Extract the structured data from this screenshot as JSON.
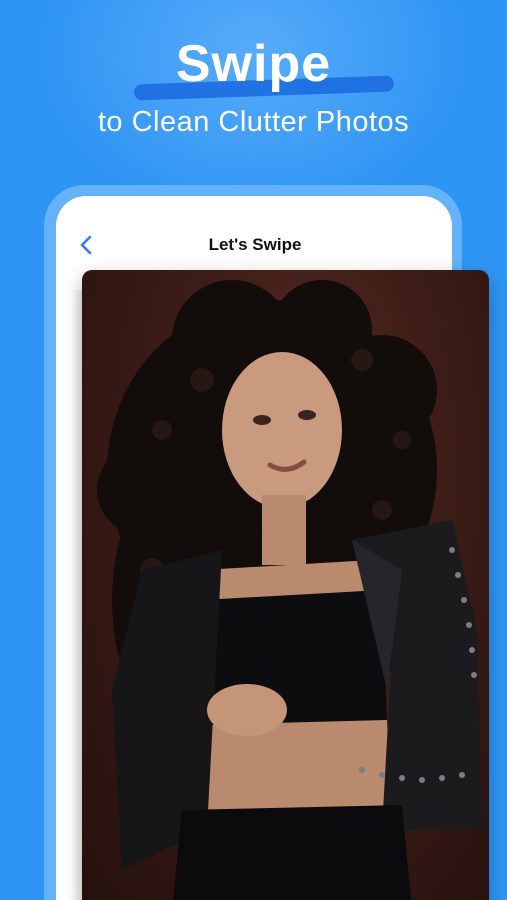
{
  "promo": {
    "title": "Swipe",
    "subtitle": "to Clean Clutter Photos"
  },
  "screen": {
    "title": "Let's Swipe",
    "back_icon": "chevron-left-icon"
  },
  "photo": {
    "description_icon": "portrait-photo"
  },
  "colors": {
    "background": "#2f95f4",
    "accent": "#1f6fe0",
    "back_icon": "#2f7cf6"
  }
}
